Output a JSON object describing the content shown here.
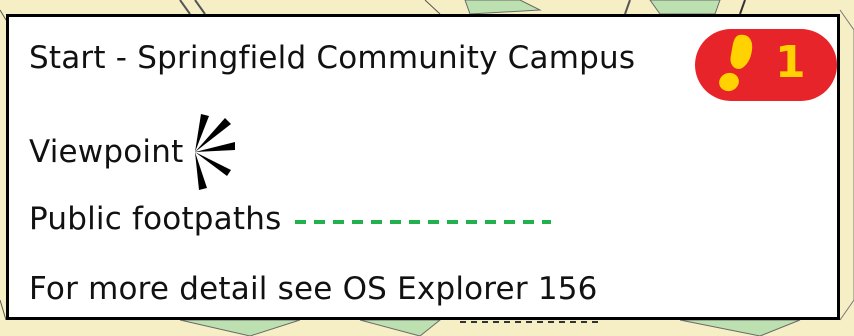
{
  "legend": {
    "start_label": "Start - Springfield Community Campus",
    "start_number": "1",
    "viewpoint_label": "Viewpoint",
    "footpaths_label": "Public footpaths",
    "footpaths_color": "#22b14c",
    "os_note": "For more detail see OS Explorer 156"
  },
  "icons": {
    "start": "footprint-icon",
    "viewpoint": "viewpoint-icon"
  },
  "colors": {
    "badge": "#e8242b",
    "badge_text": "#ffd200",
    "map_fill": "#f6efc6",
    "map_green": "#bde0b0"
  }
}
